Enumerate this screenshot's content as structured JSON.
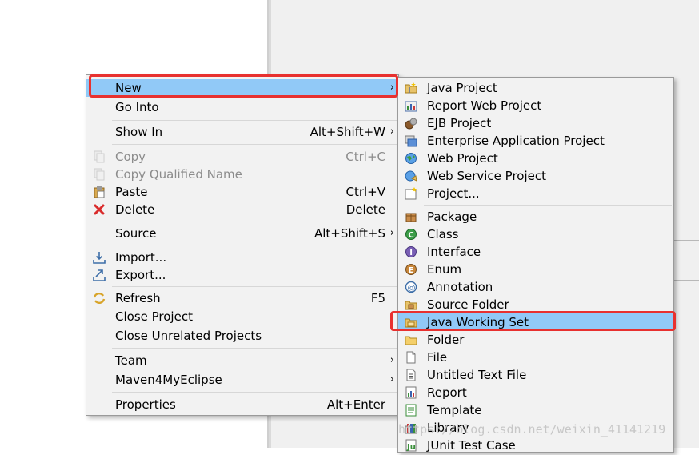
{
  "context_menu": {
    "items": [
      {
        "label": "New",
        "accel": "",
        "arrow": "›",
        "icon": "blank-icon",
        "state": "highlighted"
      },
      {
        "label": "Go Into",
        "accel": "",
        "arrow": "",
        "icon": "blank-icon",
        "state": "normal"
      },
      {
        "label": "Show In",
        "accel": "Alt+Shift+W",
        "arrow": "›",
        "icon": "blank-icon",
        "state": "normal"
      },
      {
        "label": "Copy",
        "accel": "Ctrl+C",
        "arrow": "",
        "icon": "copy-icon",
        "state": "disabled"
      },
      {
        "label": "Copy Qualified Name",
        "accel": "",
        "arrow": "",
        "icon": "copy-qualified-name-icon",
        "state": "disabled"
      },
      {
        "label": "Paste",
        "accel": "Ctrl+V",
        "arrow": "",
        "icon": "paste-icon",
        "state": "normal"
      },
      {
        "label": "Delete",
        "accel": "Delete",
        "arrow": "",
        "icon": "delete-icon",
        "state": "normal"
      },
      {
        "label": "Source",
        "accel": "Alt+Shift+S",
        "arrow": "›",
        "icon": "blank-icon",
        "state": "normal"
      },
      {
        "label": "Import...",
        "accel": "",
        "arrow": "",
        "icon": "import-icon",
        "state": "normal"
      },
      {
        "label": "Export...",
        "accel": "",
        "arrow": "",
        "icon": "export-icon",
        "state": "normal"
      },
      {
        "label": "Refresh",
        "accel": "F5",
        "arrow": "",
        "icon": "refresh-icon",
        "state": "normal"
      },
      {
        "label": "Close Project",
        "accel": "",
        "arrow": "",
        "icon": "blank-icon",
        "state": "normal"
      },
      {
        "label": "Close Unrelated Projects",
        "accel": "",
        "arrow": "",
        "icon": "blank-icon",
        "state": "normal"
      },
      {
        "label": "Team",
        "accel": "",
        "arrow": "›",
        "icon": "blank-icon",
        "state": "normal"
      },
      {
        "label": "Maven4MyEclipse",
        "accel": "",
        "arrow": "›",
        "icon": "blank-icon",
        "state": "normal"
      },
      {
        "label": "Properties",
        "accel": "Alt+Enter",
        "arrow": "",
        "icon": "blank-icon",
        "state": "normal"
      }
    ]
  },
  "new_submenu": {
    "items": [
      {
        "label": "Java Project",
        "icon": "java-project-icon",
        "state": "normal"
      },
      {
        "label": "Report Web Project",
        "icon": "report-web-project-icon",
        "state": "normal"
      },
      {
        "label": "EJB Project",
        "icon": "ejb-project-icon",
        "state": "normal"
      },
      {
        "label": "Enterprise Application Project",
        "icon": "enterprise-application-project-icon",
        "state": "normal"
      },
      {
        "label": "Web Project",
        "icon": "web-project-icon",
        "state": "normal"
      },
      {
        "label": "Web Service Project",
        "icon": "web-service-project-icon",
        "state": "normal"
      },
      {
        "label": "Project...",
        "icon": "project-icon",
        "state": "normal"
      },
      {
        "label": "Package",
        "icon": "package-icon",
        "state": "normal"
      },
      {
        "label": "Class",
        "icon": "class-icon",
        "state": "normal"
      },
      {
        "label": "Interface",
        "icon": "interface-icon",
        "state": "normal"
      },
      {
        "label": "Enum",
        "icon": "enum-icon",
        "state": "normal"
      },
      {
        "label": "Annotation",
        "icon": "annotation-icon",
        "state": "normal"
      },
      {
        "label": "Source Folder",
        "icon": "source-folder-icon",
        "state": "normal"
      },
      {
        "label": "Java Working Set",
        "icon": "java-working-set-icon",
        "state": "highlighted"
      },
      {
        "label": "Folder",
        "icon": "folder-icon",
        "state": "normal"
      },
      {
        "label": "File",
        "icon": "file-icon",
        "state": "normal"
      },
      {
        "label": "Untitled Text File",
        "icon": "untitled-text-file-icon",
        "state": "normal"
      },
      {
        "label": "Report",
        "icon": "report-icon",
        "state": "normal"
      },
      {
        "label": "Template",
        "icon": "template-icon",
        "state": "normal"
      },
      {
        "label": "Library",
        "icon": "library-icon",
        "state": "normal"
      },
      {
        "label": "JUnit Test Case",
        "icon": "junit-test-case-icon",
        "state": "normal"
      }
    ]
  },
  "watermark": "https://blog.csdn.net/weixin_41141219",
  "colors": {
    "highlight": "#91c9f7",
    "annotation_box": "#e8312f",
    "menu_background": "#f2f2f2",
    "disabled_text": "#8c8c8c"
  }
}
